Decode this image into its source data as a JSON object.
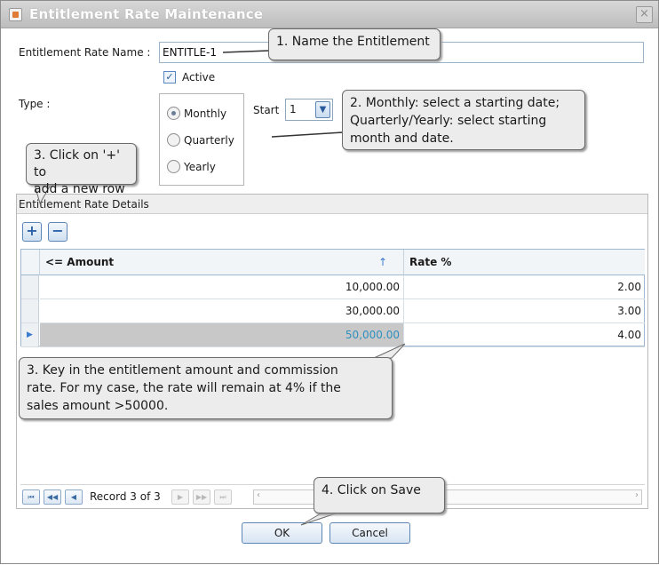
{
  "window": {
    "title": "Entitlement Rate Maintenance",
    "close_glyph": "×"
  },
  "form": {
    "name_label": "Entitlement Rate Name :",
    "name_value": "ENTITLE-1",
    "active_label": "Active",
    "active_checked": true,
    "type_label": "Type :",
    "type_options": [
      "Monthly",
      "Quarterly",
      "Yearly"
    ],
    "type_selected": "Monthly",
    "start_label": "Start",
    "start_value": "1"
  },
  "details": {
    "title": "Entitlement Rate Details",
    "add_icon": "plus-icon",
    "remove_icon": "minus-icon",
    "columns": [
      "<= Amount",
      "Rate %"
    ],
    "sort_indicator": "↑",
    "rows": [
      {
        "amount": "10,000.00",
        "rate": "2.00"
      },
      {
        "amount": "30,000.00",
        "rate": "3.00"
      },
      {
        "amount": "50,000.00",
        "rate": "4.00"
      }
    ],
    "pager_text": "Record 3 of 3"
  },
  "buttons": {
    "ok": "OK",
    "cancel": "Cancel"
  },
  "callouts": {
    "c1": "1. Name the Entitlement",
    "c2_line1": "2. Monthly: select a starting date;",
    "c2_line2": "Quarterly/Yearly: select starting",
    "c2_line3": "month and date.",
    "c3a_line1": "3. Click on '+' to",
    "c3a_line2": "add a new row",
    "c3b_line1": "3. Key in the entitlement amount and commission",
    "c3b_line2": "rate. For my case, the rate will remain at 4% if the",
    "c3b_line3": "sales amount >50000.",
    "c4": "4. Click on Save"
  },
  "colors": {
    "selected_cell_bg": "#c8c8c8",
    "selected_cell_text": "#2f8fbf",
    "accent": "#5c86b5"
  }
}
